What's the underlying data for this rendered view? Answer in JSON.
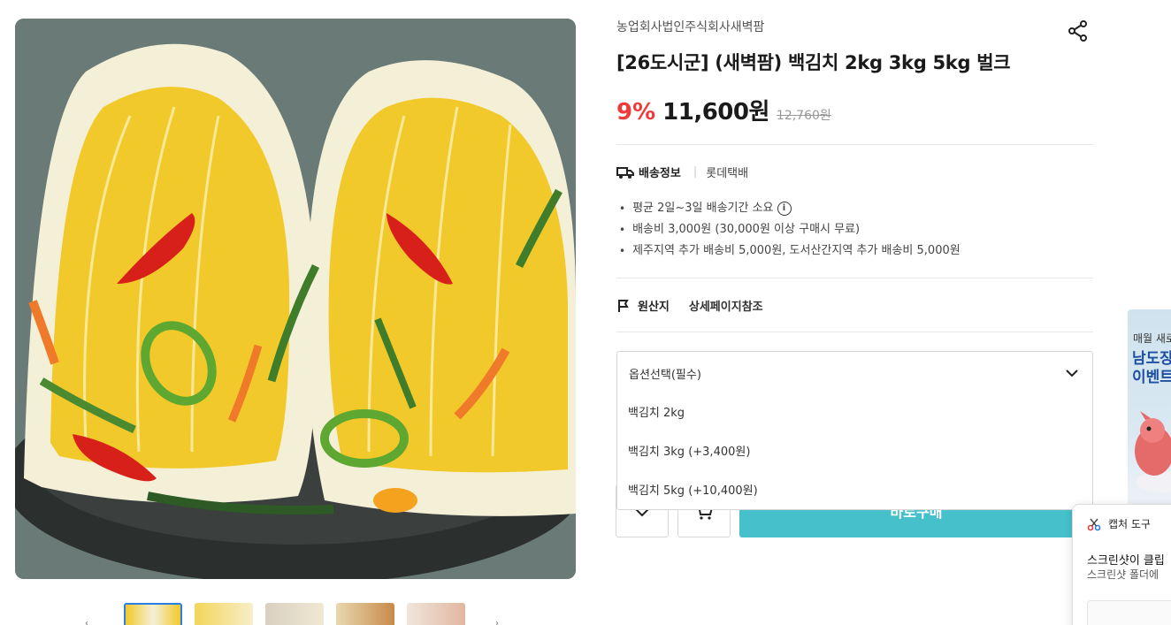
{
  "product": {
    "seller": "농업회사법인주식회사새벽팜",
    "title": "[26도시군] (새벽팜) 백김치 2kg 3kg 5kg 벌크",
    "discount": "9%",
    "price": "11,600원",
    "original_price": "12,760원"
  },
  "shipping": {
    "label": "배송정보",
    "company": "롯데택배",
    "notes": [
      "평균 2일~3일 배송기간 소요",
      "배송비 3,000원 (30,000원 이상 구매시 무료)",
      "제주지역 추가 배송비 5,000원, 도서산간지역 추가 배송비 5,000원"
    ]
  },
  "origin": {
    "label": "원산지",
    "value": "상세페이지참조"
  },
  "options": {
    "placeholder": "옵션선택(필수)",
    "items": [
      "백김치 2kg",
      "백김치 3kg (+3,400원)",
      "백김치 5kg (+10,400원)"
    ]
  },
  "actions": {
    "buy_label": "바로구매"
  },
  "banner": {
    "subtitle": "매월 새로",
    "title_line1": "남도장",
    "title_line2": "이벤트"
  },
  "toast": {
    "app_name": "캡처 도구",
    "message": "스크린샷이 클립",
    "sub": "스크린샷 폴더에"
  },
  "icons": {
    "share": "share-icon",
    "truck": "truck-icon",
    "info": "info-icon",
    "flag": "flag-icon",
    "chevron": "chevron-down-icon",
    "wish": "chevron-down-icon",
    "cart": "cart-icon"
  },
  "colors": {
    "discount": "#f03a3a",
    "buy_button": "#46c1cc",
    "active_thumb": "#2a7de1"
  }
}
